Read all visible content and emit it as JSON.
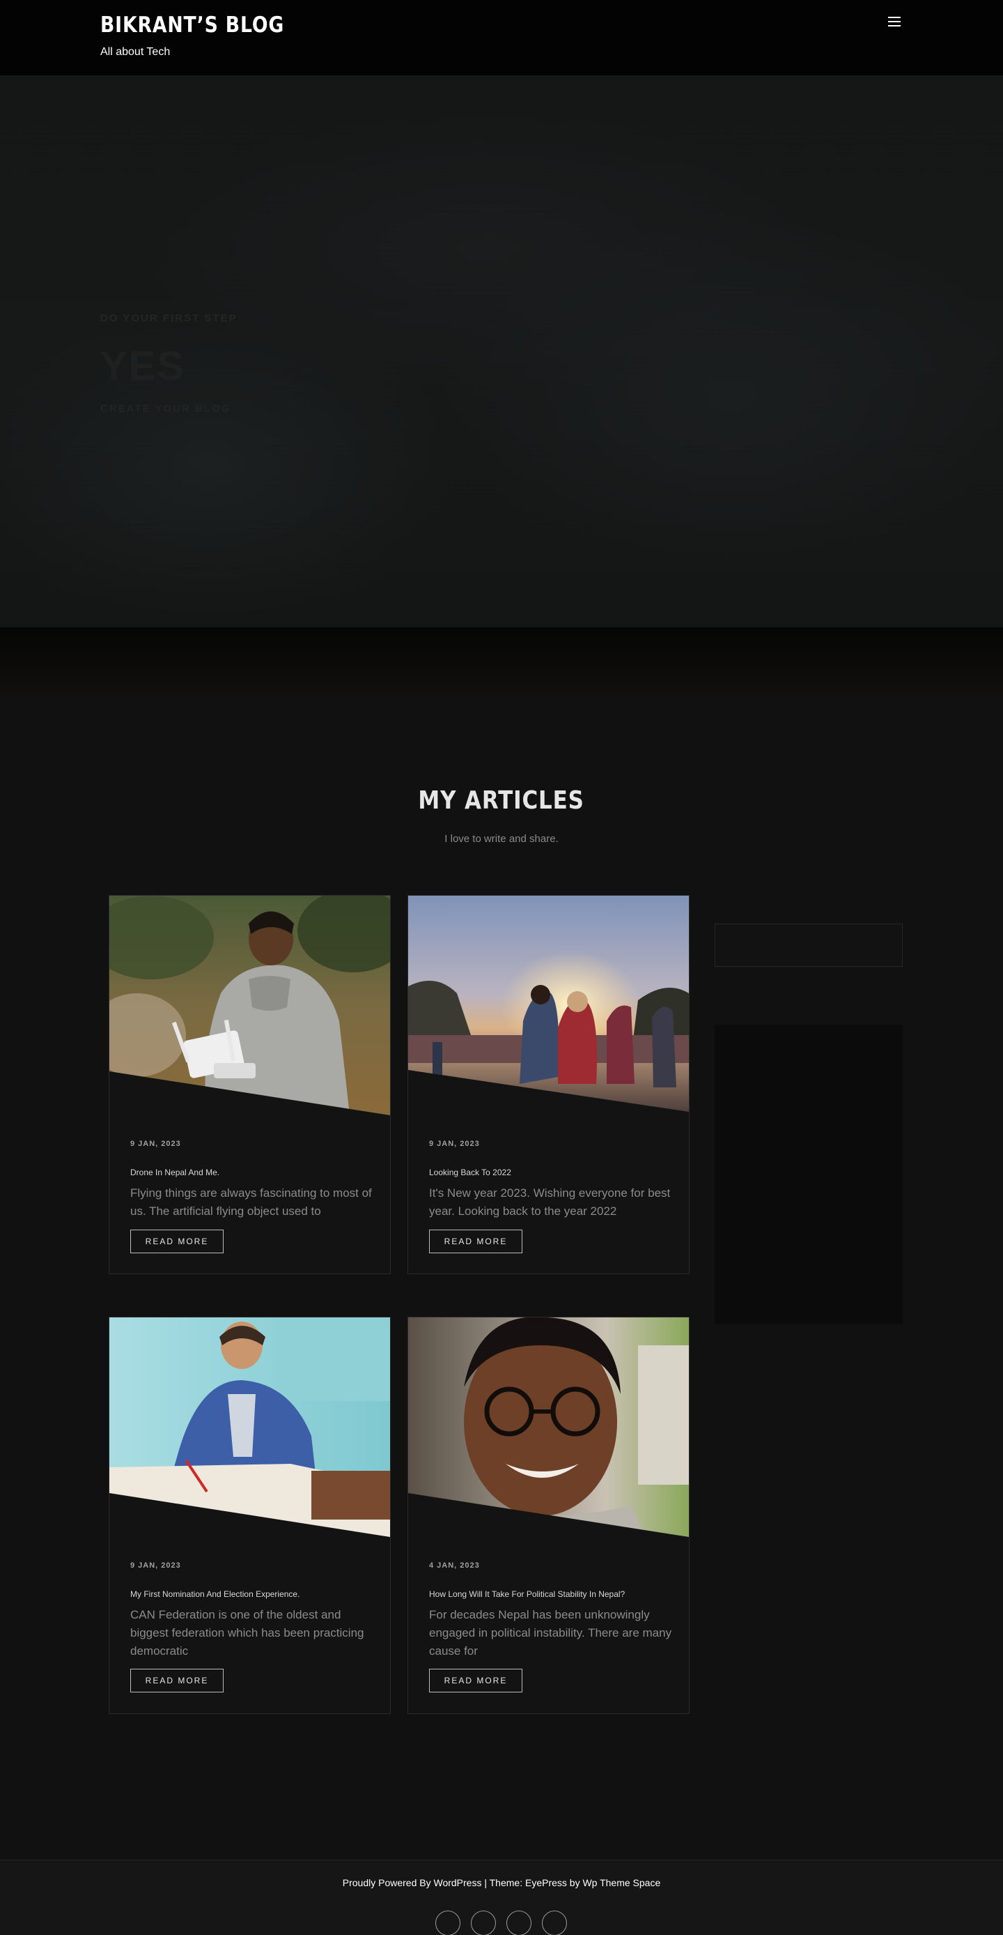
{
  "header": {
    "site_title": "BIKRANT’S BLOG",
    "tagline": "All about Tech",
    "menu_icon": "hamburger-menu-icon"
  },
  "hero": {
    "kicker": "DO YOUR FIRST STEP",
    "heading": "YES",
    "subheading": "CREATE YOUR BLOG"
  },
  "articles_section": {
    "title": "MY ARTICLES",
    "subtitle": "I love to write and share."
  },
  "articles": [
    {
      "date": "9 JAN, 2023",
      "title": "Drone In Nepal And Me.",
      "excerpt": "Flying things are always fascinating to most of us. The artificial flying object used to",
      "read_more": "READ MORE"
    },
    {
      "date": "9 JAN, 2023",
      "title": "Looking Back To 2022",
      "excerpt": "It's New year 2023. Wishing everyone for best year. Looking back to the year 2022",
      "read_more": "READ MORE"
    },
    {
      "date": "9 JAN, 2023",
      "title": "My First Nomination And Election Experience.",
      "excerpt": "CAN Federation is one of the oldest and biggest federation which has been practicing democratic",
      "read_more": "READ MORE"
    },
    {
      "date": "4 JAN, 2023",
      "title": "How Long Will It Take For Political Stability In Nepal?",
      "excerpt": "For decades Nepal has been unknowingly engaged in political instability. There are many cause for",
      "read_more": "READ MORE"
    }
  ],
  "footer": {
    "credit": "Proudly Powered By WordPress | Theme: EyePress by Wp Theme Space",
    "social_glyph": "",
    "social_icons": [
      "social-icon-1",
      "social-icon-2",
      "social-icon-3",
      "social-icon-4"
    ]
  },
  "colors": {
    "background": "#111111",
    "header": "#030303",
    "card_border": "#2b2b2b",
    "text_muted": "#8b8b8b"
  }
}
